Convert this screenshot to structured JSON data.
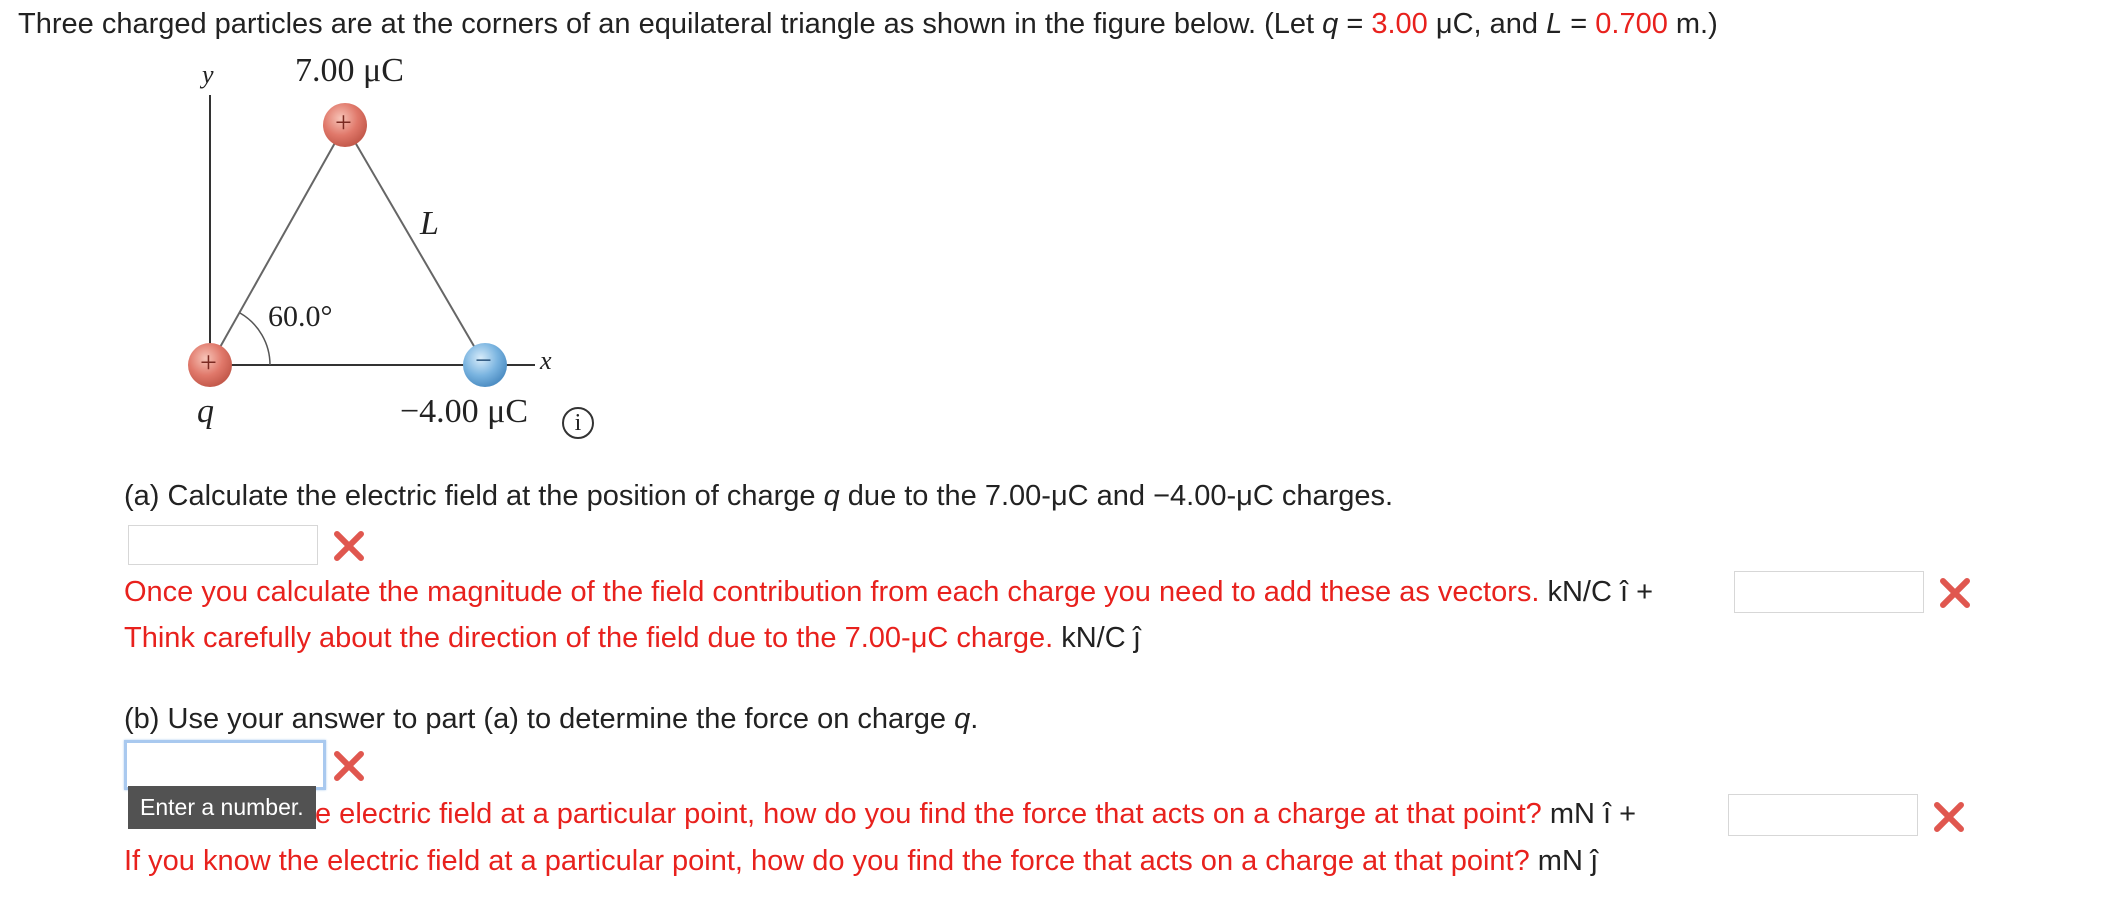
{
  "problem": {
    "intro_prefix": "Three charged particles are at the corners of an equilateral triangle as shown in the figure below. (Let ",
    "q_var": "q",
    "eq1": " = ",
    "q_value": "3.00",
    "q_unit": " μC, and ",
    "L_var": "L",
    "eq2": " = ",
    "L_value": "0.700",
    "L_unit": " m.)"
  },
  "figure": {
    "y_label": "y",
    "x_label": "x",
    "top_charge_label": "7.00 μC",
    "side_label": "L",
    "angle_label": "60.0°",
    "left_charge_label": "q",
    "right_charge_label": "−4.00 μC",
    "plus_sign": "+",
    "minus_sign": "−",
    "info_glyph": "i",
    "colors": {
      "positive": "#e0786a",
      "negative": "#7ab4e0"
    }
  },
  "part_a": {
    "question_prefix": "(a) Calculate the electric field at the position of charge ",
    "question_var": "q",
    "question_suffix": " due to the 7.00-μC and −4.00-μC charges.",
    "feedback_i": "Once you calculate the magnitude of the field contribution from each charge you need to add these as vectors.",
    "unit_i": " kN/C î + ",
    "feedback_j": "Think carefully about the direction of the field due to the 7.00-μC charge.",
    "unit_j": " kN/C ĵ"
  },
  "part_b": {
    "question_prefix": "(b) Use your answer to part (a) to determine the force on charge ",
    "question_var": "q",
    "question_suffix": ".",
    "tooltip": "Enter a number.",
    "feedback_i_visible": "e electric field at a particular point, how do you find the force that acts on a charge at that point?",
    "unit_i": " mN î + ",
    "feedback_j": "If you know the electric field at a particular point, how do you find the force that acts on a charge at that point?",
    "unit_j": " mN ĵ"
  },
  "colors": {
    "feedback": "#e8211d",
    "wrong_mark": "#e0574f",
    "focus_border": "#a9c9ef"
  }
}
